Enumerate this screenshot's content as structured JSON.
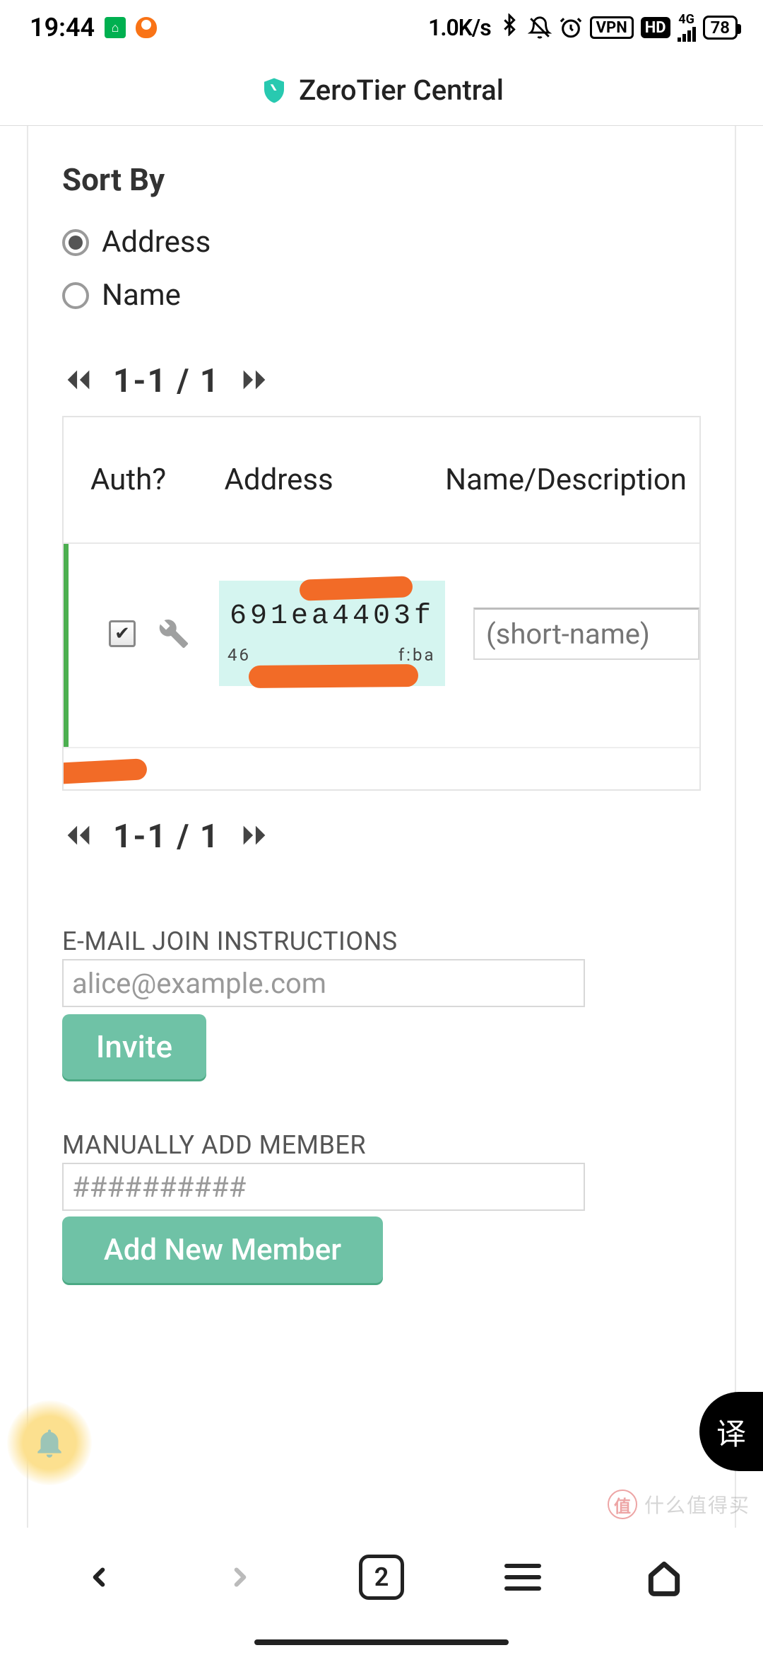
{
  "status": {
    "time": "19:44",
    "speed": "1.0K/s",
    "vpn": "VPN",
    "hd": "HD",
    "signal": "4G",
    "battery": "78"
  },
  "header": {
    "title": "ZeroTier Central"
  },
  "sort": {
    "heading": "Sort By",
    "options": [
      "Address",
      "Name"
    ],
    "selected": "Address"
  },
  "pagination": {
    "text": "1-1 / 1"
  },
  "table": {
    "headers": {
      "auth": "Auth?",
      "address": "Address",
      "name": "Name/Description"
    },
    "rows": [
      {
        "authorized": true,
        "address": "691ea4403f",
        "sub_prefix": "46",
        "sub_suffix": "f:ba",
        "short_name_placeholder": "(short-name)"
      }
    ]
  },
  "email_section": {
    "label": "E-MAIL JOIN INSTRUCTIONS",
    "placeholder": "alice@example.com",
    "button": "Invite"
  },
  "manual_section": {
    "label": "MANUALLY ADD MEMBER",
    "placeholder": "##########",
    "button": "Add New Member"
  },
  "translate": "译",
  "watermark": {
    "logo": "值",
    "text": "什么值得买"
  },
  "nav": {
    "tab_count": "2"
  }
}
